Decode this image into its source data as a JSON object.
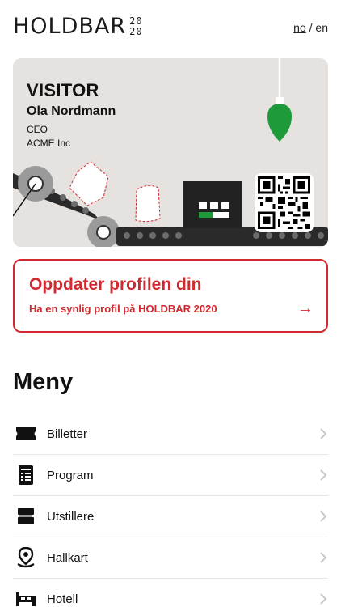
{
  "header": {
    "logo_word": "HOLDBAR",
    "logo_year_top": "20",
    "logo_year_bottom": "20",
    "lang_no": "no",
    "lang_sep": "/",
    "lang_en": "en",
    "active_lang": "no"
  },
  "badge": {
    "role": "VISITOR",
    "name": "Ola Nordmann",
    "title": "CEO",
    "company": "ACME Inc",
    "icons": [
      "lightbulb-icon",
      "conveyor-illustration",
      "qr-code"
    ]
  },
  "update_card": {
    "title": "Oppdater profilen din",
    "subtitle": "Ha en synlig profil på HOLDBAR 2020",
    "arrow": "→"
  },
  "menu": {
    "title": "Meny",
    "items": [
      {
        "label": "Billetter",
        "icon": "ticket-icon"
      },
      {
        "label": "Program",
        "icon": "program-icon"
      },
      {
        "label": "Utstillere",
        "icon": "exhibitor-booth-icon"
      },
      {
        "label": "Hallkart",
        "icon": "map-pin-icon"
      },
      {
        "label": "Hotell",
        "icon": "bed-icon"
      }
    ]
  },
  "colors": {
    "accent_red": "#d0292f",
    "badge_bg": "#e6e2df",
    "bulb_green": "#1f9a3a"
  }
}
